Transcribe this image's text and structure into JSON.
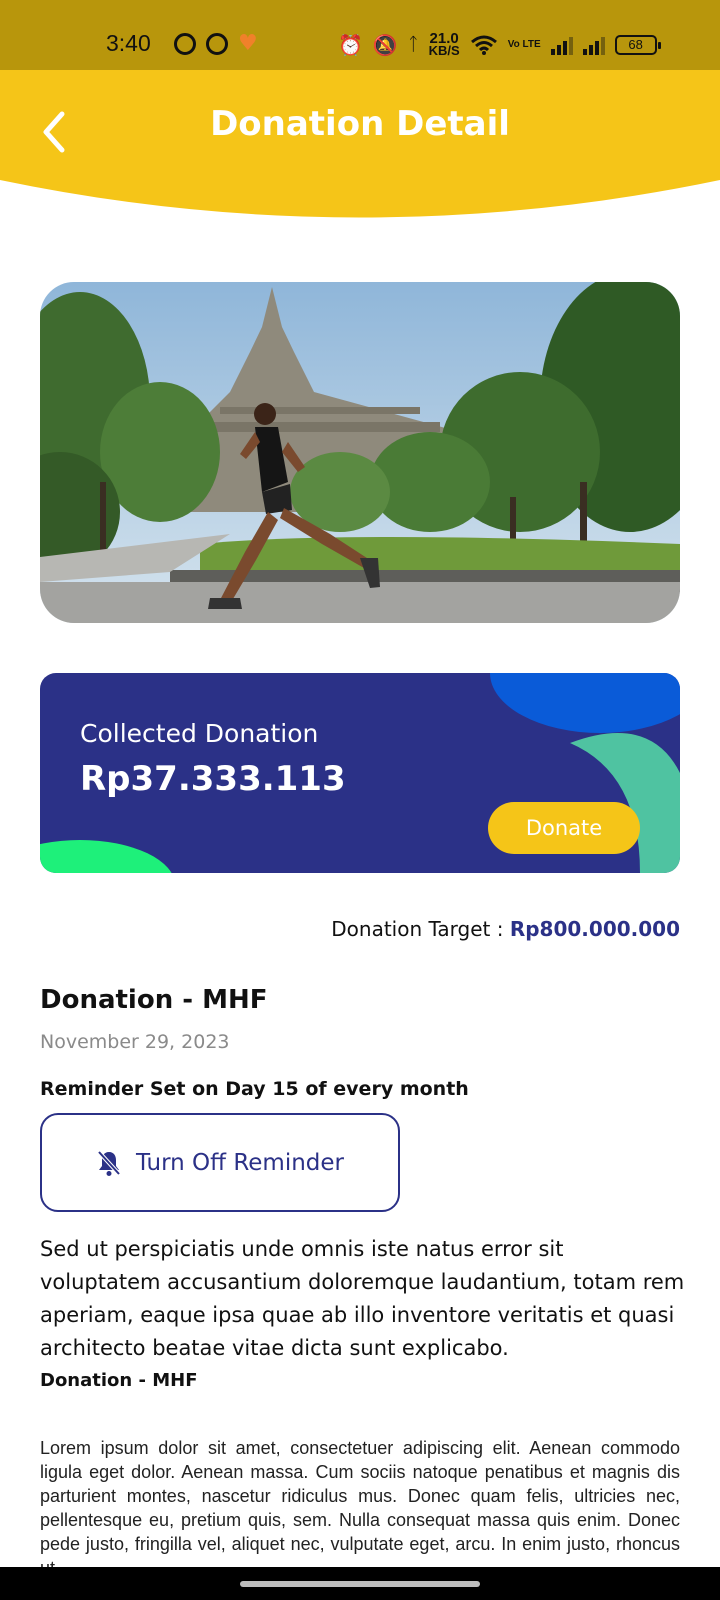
{
  "status_bar": {
    "time": "3:40",
    "speed_value": "21.0",
    "speed_unit": "KB/S",
    "lte": "Vo LTE",
    "battery": "68"
  },
  "header": {
    "title": "Donation Detail",
    "background_color": "#f5c518"
  },
  "card": {
    "label": "Collected Donation",
    "amount": "Rp37.333.113",
    "donate_label": "Donate",
    "background_color": "#2b3187"
  },
  "target": {
    "label": "Donation Target : ",
    "value": "Rp800.000.000"
  },
  "donation": {
    "title": "Donation - MHF",
    "date": "November 29, 2023",
    "reminder_text": "Reminder Set on Day 15 of every month",
    "reminder_button": "Turn Off Reminder",
    "description": "Sed ut perspiciatis unde omnis iste natus error sit voluptatem accusantium doloremque laudantium, totam rem aperiam, eaque ipsa quae ab illo inventore veritatis et quasi architecto beatae vitae dicta sunt explicabo.",
    "subtitle": "Donation - MHF",
    "body": "Lorem ipsum dolor sit amet, consectetuer adipiscing elit. Aenean commodo ligula eget dolor. Aenean massa. Cum sociis natoque penatibus et magnis dis parturient montes, nascetur ridiculus mus. Donec quam felis, ultricies nec, pellentesque eu, pretium quis, sem. Nulla consequat massa quis enim. Donec pede justo, fringilla vel, aliquet nec, vulputate eget, arcu. In enim justo, rhoncus ut"
  },
  "icons": {
    "back": "chevron-left-icon",
    "reminder": "bell-off-icon"
  }
}
